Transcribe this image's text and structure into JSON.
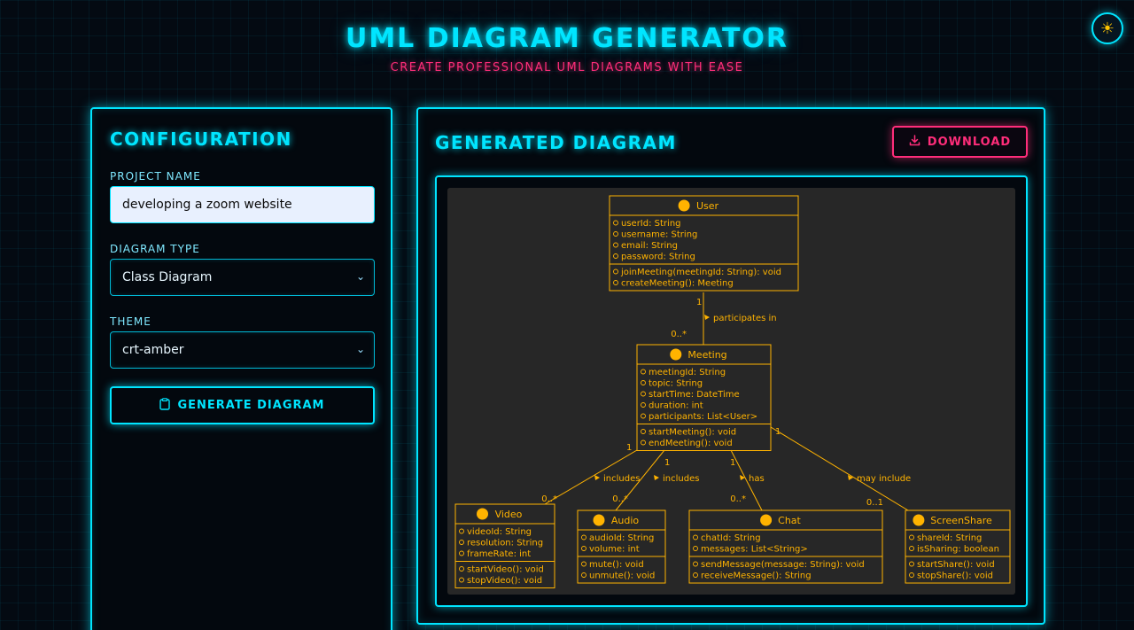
{
  "header": {
    "title": "UML DIAGRAM GENERATOR",
    "subtitle": "CREATE PROFESSIONAL UML DIAGRAMS WITH EASE"
  },
  "theme_toggle": {
    "icon": "sun-icon"
  },
  "config": {
    "heading": "CONFIGURATION",
    "project_name_label": "PROJECT NAME",
    "project_name_value": "developing a zoom website",
    "diagram_type_label": "DIAGRAM TYPE",
    "diagram_type_value": "Class Diagram",
    "theme_label": "THEME",
    "theme_value": "crt-amber",
    "generate_label": "GENERATE DIAGRAM"
  },
  "diagram_panel": {
    "heading": "GENERATED DIAGRAM",
    "download_label": "DOWNLOAD"
  },
  "diagram": {
    "classes": [
      {
        "name": "User",
        "attributes": [
          "userId: String",
          "username: String",
          "email: String",
          "password: String"
        ],
        "methods": [
          "joinMeeting(meetingId: String): void",
          "createMeeting(): Meeting"
        ]
      },
      {
        "name": "Meeting",
        "attributes": [
          "meetingId: String",
          "topic: String",
          "startTime: DateTime",
          "duration: int",
          "participants: List<User>"
        ],
        "methods": [
          "startMeeting(): void",
          "endMeeting(): void"
        ]
      },
      {
        "name": "Video",
        "attributes": [
          "videoId: String",
          "resolution: String",
          "frameRate: int"
        ],
        "methods": [
          "startVideo(): void",
          "stopVideo(): void"
        ]
      },
      {
        "name": "Audio",
        "attributes": [
          "audioId: String",
          "volume: int"
        ],
        "methods": [
          "mute(): void",
          "unmute(): void"
        ]
      },
      {
        "name": "Chat",
        "attributes": [
          "chatId: String",
          "messages: List<String>"
        ],
        "methods": [
          "sendMessage(message: String): void",
          "receiveMessage(): String"
        ]
      },
      {
        "name": "ScreenShare",
        "attributes": [
          "shareId: String",
          "isSharing: boolean"
        ],
        "methods": [
          "startShare(): void",
          "stopShare(): void"
        ]
      }
    ],
    "relations": [
      {
        "from": "User",
        "to": "Meeting",
        "label": "participates in",
        "from_mult": "1",
        "to_mult": "0..*"
      },
      {
        "from": "Meeting",
        "to": "Video",
        "label": "includes",
        "from_mult": "1",
        "to_mult": "0..*"
      },
      {
        "from": "Meeting",
        "to": "Audio",
        "label": "includes",
        "from_mult": "1",
        "to_mult": "0..*"
      },
      {
        "from": "Meeting",
        "to": "Chat",
        "label": "has",
        "from_mult": "1",
        "to_mult": "0..*"
      },
      {
        "from": "Meeting",
        "to": "ScreenShare",
        "label": "may include",
        "from_mult": "1",
        "to_mult": "0..1"
      }
    ],
    "colors": {
      "line": "#ffb300",
      "background": "#272727",
      "accent": "#00e5ff",
      "danger": "#ff2d7a"
    }
  }
}
